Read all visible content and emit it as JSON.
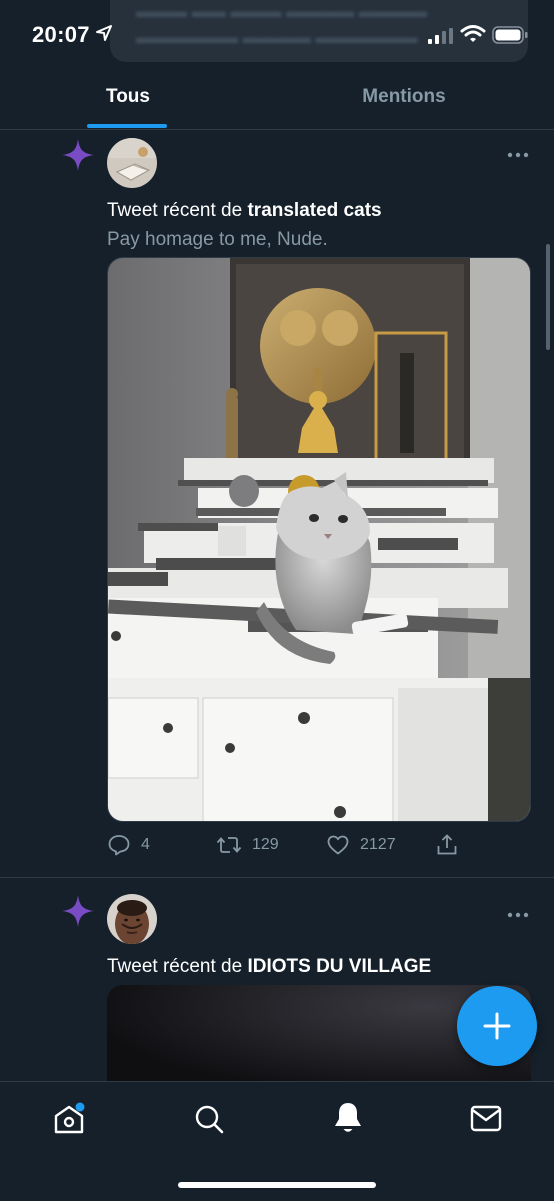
{
  "status_bar": {
    "time": "20:07"
  },
  "tabs": [
    {
      "label": "Tous",
      "active": true
    },
    {
      "label": "Mentions",
      "active": false
    }
  ],
  "tweets": [
    {
      "recent_prefix": "Tweet récent de ",
      "account": "translated cats",
      "text": "Pay homage to me, Nude.",
      "media": "cat-on-altar-photo",
      "replies": "4",
      "retweets": "129",
      "likes": "2127"
    },
    {
      "recent_prefix": "Tweet récent de ",
      "account": "IDIOTS DU VILLAGE",
      "media": "dark-video-preview"
    }
  ],
  "nav": [
    "home-icon",
    "search-icon",
    "notifications-icon",
    "messages-icon"
  ],
  "colors": {
    "background": "#15202b",
    "accent": "#1d9bf0",
    "sparkle": "#794bc4",
    "muted": "#8899a6"
  }
}
